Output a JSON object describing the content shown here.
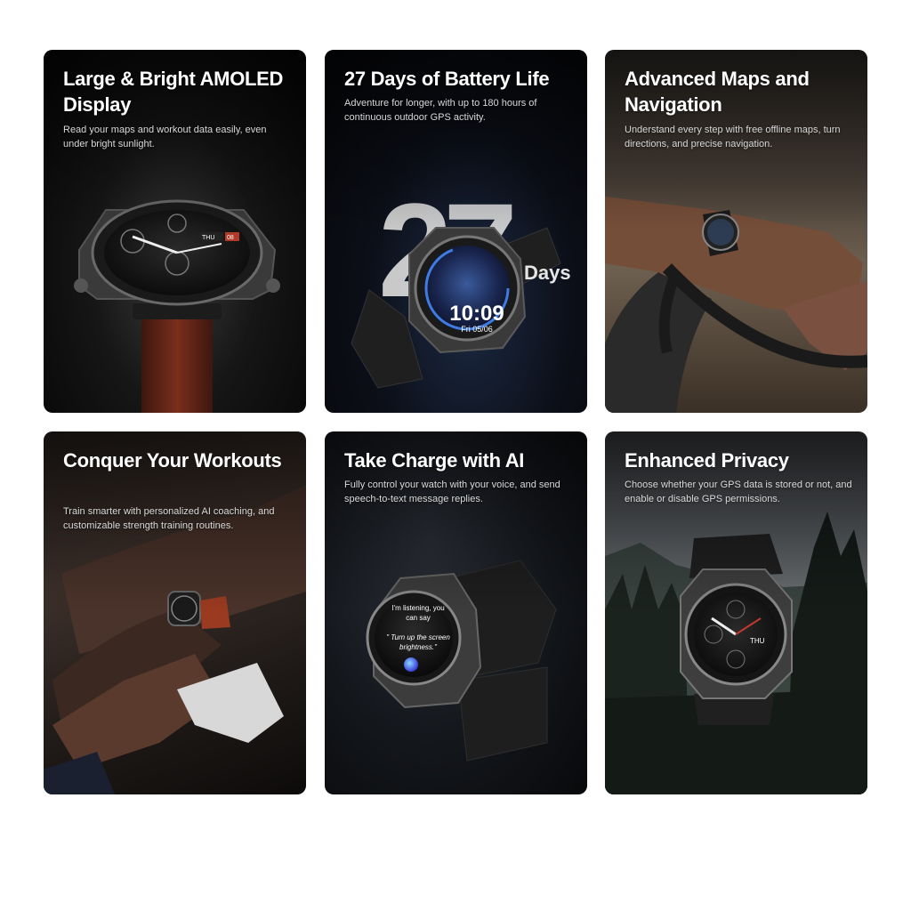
{
  "cards": [
    {
      "title": "Large & Bright AMOLED Display",
      "desc": "Read your maps and workout data easily, even under bright sunlight.",
      "watch_day": "THU",
      "watch_date": "08"
    },
    {
      "title": "27 Days of Battery Life",
      "desc": "Adventure for longer, with up to 180 hours of continuous outdoor GPS activity.",
      "big_number": "27",
      "days_label": "Days",
      "watch_time": "10:09",
      "watch_date": "Fri 05/06"
    },
    {
      "title": "Advanced Maps and Navigation",
      "desc": "Understand every step with free offline maps, turn directions, and precise navigation."
    },
    {
      "title": "Conquer Your Workouts",
      "desc": "Train smarter with personalized AI coaching, and customizable strength training routines."
    },
    {
      "title": "Take Charge with AI",
      "desc": "Fully control your watch with your voice, and send speech-to-text message replies.",
      "watch_line1": "I'm listening, you can say",
      "watch_line2": "\" Turn up the screen brightness.\""
    },
    {
      "title": "Enhanced Privacy",
      "desc": "Choose whether your GPS data is stored or not, and enable or disable GPS permissions.",
      "watch_day": "THU"
    }
  ]
}
